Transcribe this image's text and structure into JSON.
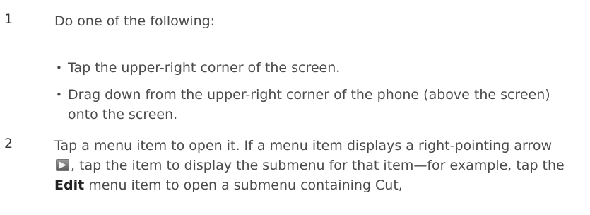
{
  "steps": [
    {
      "number": "1",
      "text": "Do one of the following:",
      "bullets": [
        "Tap the upper-right corner of the screen.",
        "Drag down from the upper-right corner of the phone (above the screen) onto the screen."
      ]
    },
    {
      "number": "2",
      "text_part1": "Tap a menu item to open it. If a menu item displays a right-pointing arrow",
      "text_part2": ", tap the item to display the submenu for that item—for example, tap the",
      "bold_term": "Edit",
      "text_part3": "menu item to open a submenu containing Cut,"
    }
  ],
  "bullet_glyph": "•",
  "icons": {
    "submenu_arrow": "right-arrow-icon"
  }
}
